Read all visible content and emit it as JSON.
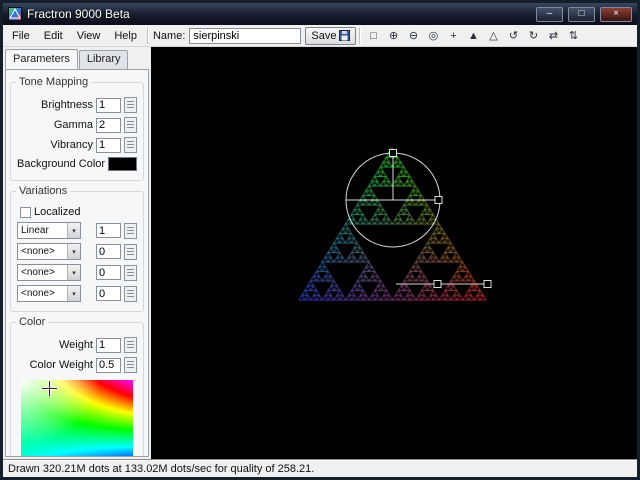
{
  "window": {
    "title": "Fractron 9000 Beta",
    "controls": {
      "minimize": "–",
      "maximize": "□",
      "close": "×"
    }
  },
  "menubar": {
    "items": [
      "File",
      "Edit",
      "View",
      "Help"
    ],
    "name_label": "Name:",
    "name_value": "sierpinski",
    "save_label": "Save"
  },
  "toolbar": {
    "buttons": [
      {
        "name": "new-flame",
        "glyph": "□"
      },
      {
        "name": "zoom-in",
        "glyph": "⊕"
      },
      {
        "name": "zoom-out",
        "glyph": "⊖"
      },
      {
        "name": "reset-view",
        "glyph": "◎"
      },
      {
        "name": "pan-view",
        "glyph": "+"
      },
      {
        "name": "add-transform",
        "glyph": "▲"
      },
      {
        "name": "remove-transform",
        "glyph": "△"
      },
      {
        "name": "undo",
        "glyph": "↺"
      },
      {
        "name": "redo",
        "glyph": "↻"
      },
      {
        "name": "flip-horizontal",
        "glyph": "⇄"
      },
      {
        "name": "flip-vertical",
        "glyph": "⇅"
      }
    ]
  },
  "tabs": {
    "parameters": "Parameters",
    "library": "Library"
  },
  "icons": {
    "chevron_down": "▾"
  },
  "panel": {
    "tone_mapping": {
      "title": "Tone Mapping",
      "brightness_label": "Brightness",
      "brightness": "1",
      "gamma_label": "Gamma",
      "gamma": "2",
      "vibrancy_label": "Vibrancy",
      "vibrancy": "1",
      "background_label": "Background Color",
      "background_color": "#000000"
    },
    "variations": {
      "title": "Variations",
      "localized_label": "Localized",
      "rows": [
        {
          "option": "Linear",
          "value": "1"
        },
        {
          "option": "<none>",
          "value": "0"
        },
        {
          "option": "<none>",
          "value": "0"
        },
        {
          "option": "<none>",
          "value": "0"
        }
      ]
    },
    "color": {
      "title": "Color",
      "weight_label": "Weight",
      "weight": "1",
      "color_weight_label": "Color Weight",
      "color_weight": "0.5"
    }
  },
  "fractal": {
    "type": "sierpinski",
    "depth": 5,
    "corner_colors": {
      "top": "#2dff2d",
      "bottom_left": "#3c50ff",
      "bottom_right": "#ff3232"
    },
    "overlay_color": "#ffffff"
  },
  "statusbar": {
    "text": "Drawn 320.21M dots at 133.02M dots/sec for quality of 258.21."
  }
}
